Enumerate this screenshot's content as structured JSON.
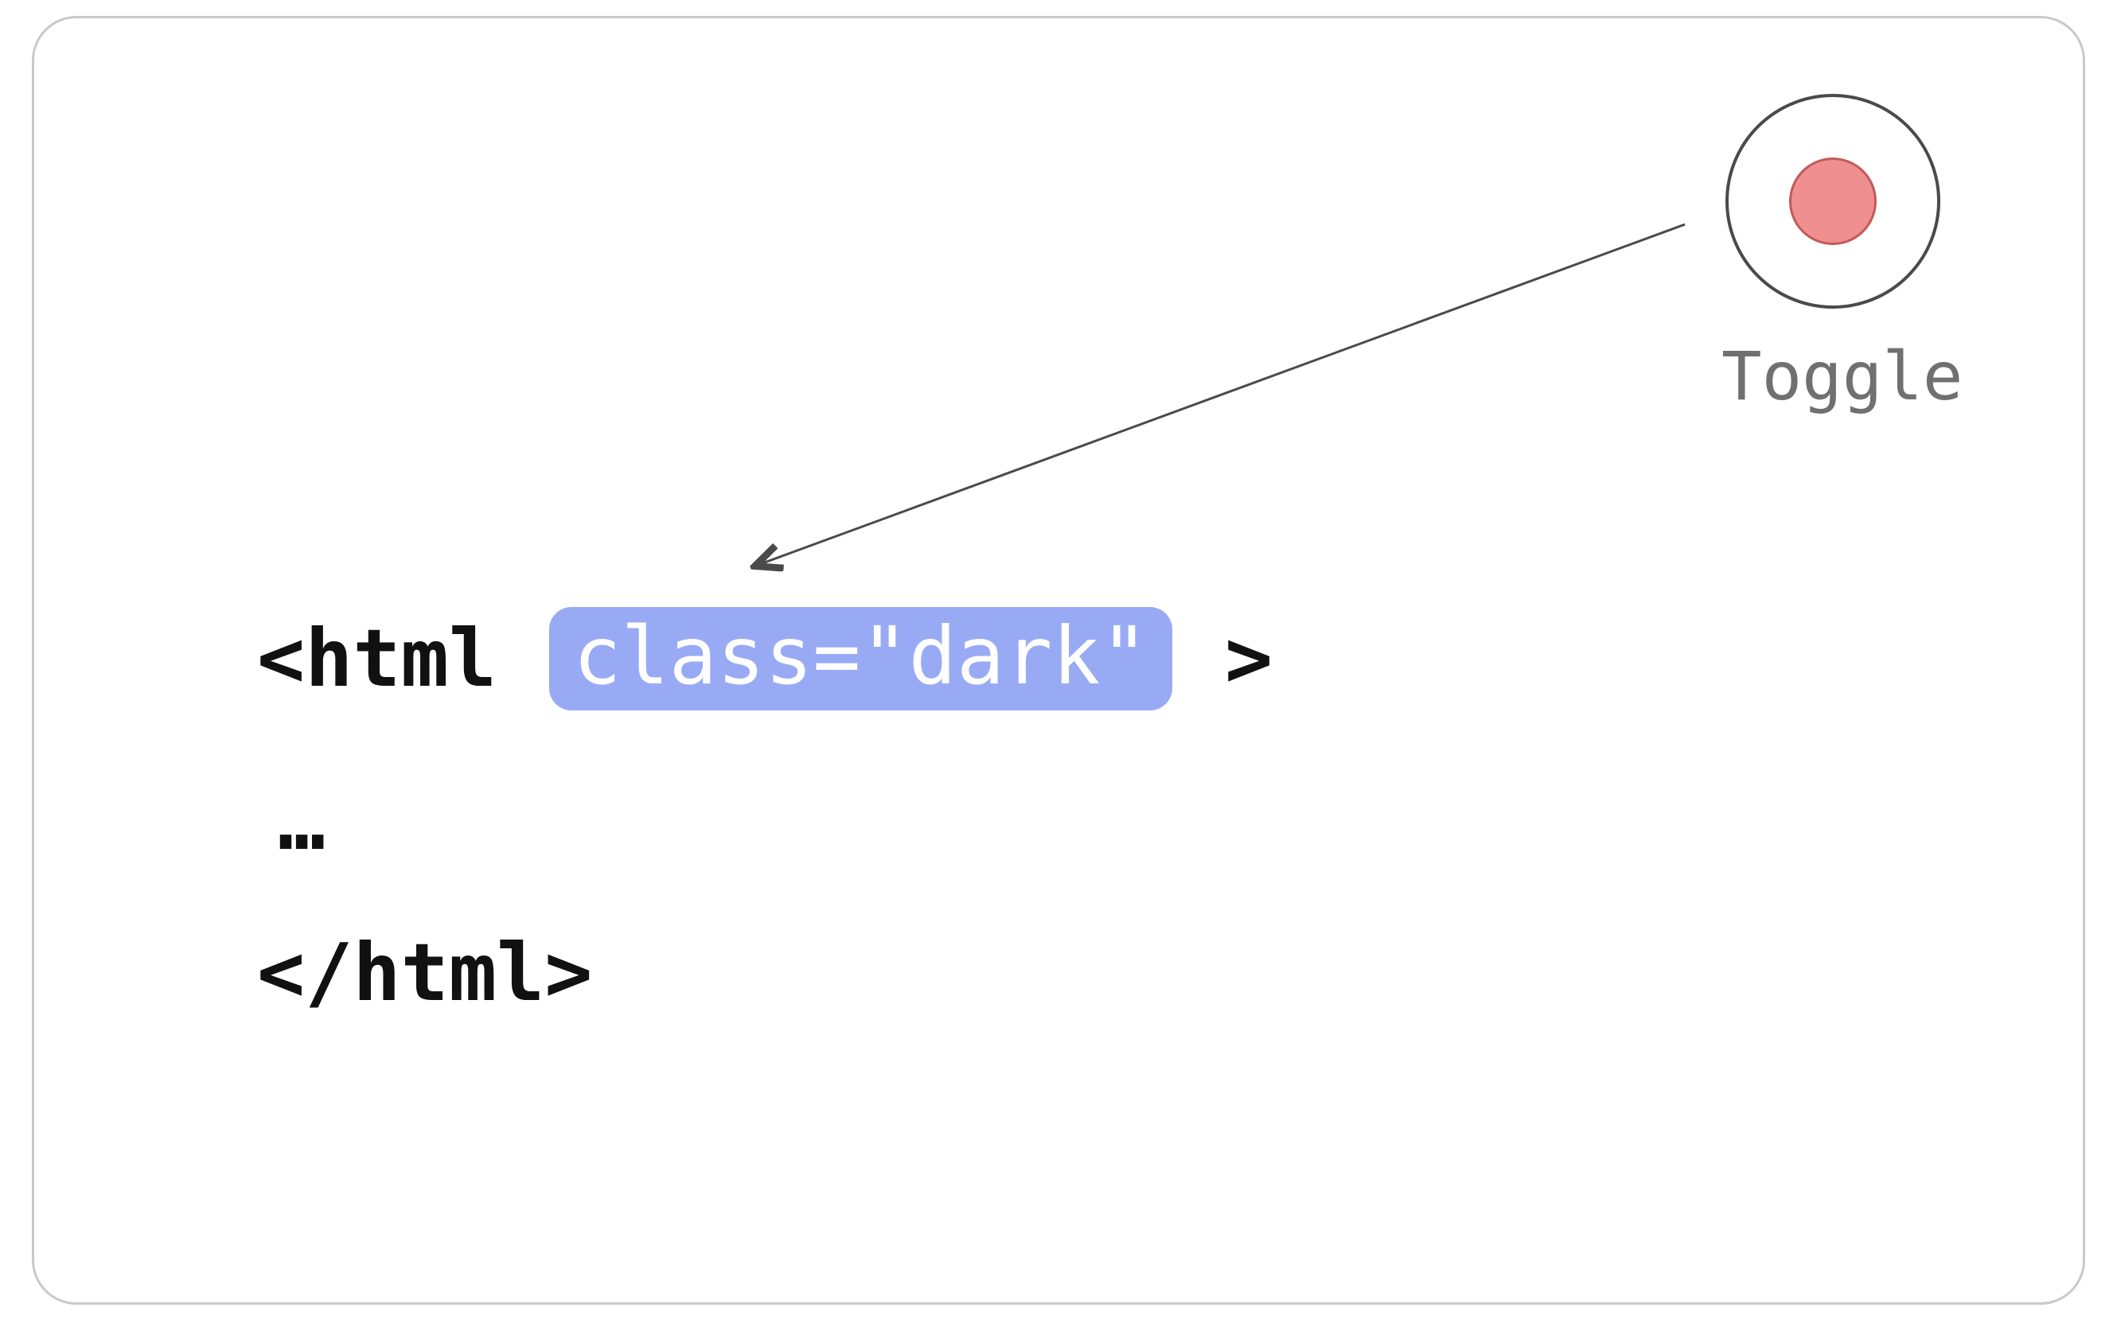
{
  "toggle": {
    "label": "Toggle"
  },
  "code": {
    "open_prefix": "<html",
    "attr_text": "class=\"dark\"",
    "open_suffix": ">",
    "ellipsis": "…",
    "close": "</html>"
  },
  "colors": {
    "highlight_bg": "#99aaf5",
    "highlight_fg": "#ffffff",
    "toggle_dot": "#ef8f8f",
    "border": "#c9c9c9",
    "text_muted": "#707070"
  }
}
